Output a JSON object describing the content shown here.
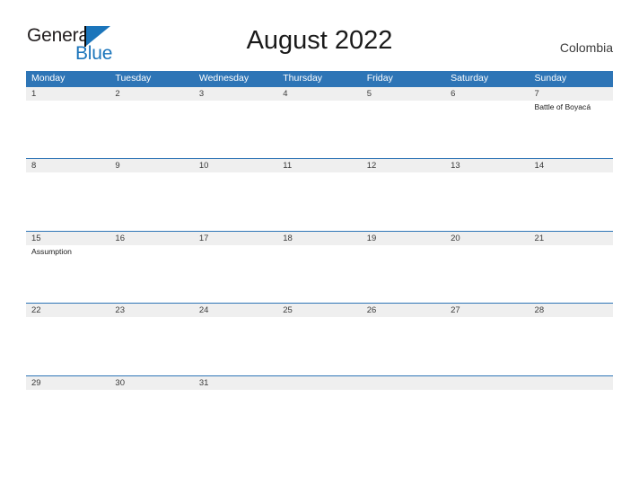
{
  "brand": {
    "name_part1": "General",
    "name_part2": "Blue",
    "flag_icon": "flag-triangle-icon",
    "accent_color": "#1b75bb"
  },
  "header": {
    "title": "August 2022",
    "locale": "Colombia"
  },
  "colors": {
    "header_blue": "#2e75b6",
    "band_gray": "#efefef",
    "text_dark": "#3a3a3a",
    "white": "#ffffff"
  },
  "calendar": {
    "month": "August",
    "year": "2022",
    "country": "Colombia",
    "weekdays": [
      "Monday",
      "Tuesday",
      "Wednesday",
      "Thursday",
      "Friday",
      "Saturday",
      "Sunday"
    ],
    "weeks": [
      {
        "days": [
          {
            "num": "1",
            "event": ""
          },
          {
            "num": "2",
            "event": ""
          },
          {
            "num": "3",
            "event": ""
          },
          {
            "num": "4",
            "event": ""
          },
          {
            "num": "5",
            "event": ""
          },
          {
            "num": "6",
            "event": ""
          },
          {
            "num": "7",
            "event": "Battle of Boyacá"
          }
        ]
      },
      {
        "days": [
          {
            "num": "8",
            "event": ""
          },
          {
            "num": "9",
            "event": ""
          },
          {
            "num": "10",
            "event": ""
          },
          {
            "num": "11",
            "event": ""
          },
          {
            "num": "12",
            "event": ""
          },
          {
            "num": "13",
            "event": ""
          },
          {
            "num": "14",
            "event": ""
          }
        ]
      },
      {
        "days": [
          {
            "num": "15",
            "event": "Assumption"
          },
          {
            "num": "16",
            "event": ""
          },
          {
            "num": "17",
            "event": ""
          },
          {
            "num": "18",
            "event": ""
          },
          {
            "num": "19",
            "event": ""
          },
          {
            "num": "20",
            "event": ""
          },
          {
            "num": "21",
            "event": ""
          }
        ]
      },
      {
        "days": [
          {
            "num": "22",
            "event": ""
          },
          {
            "num": "23",
            "event": ""
          },
          {
            "num": "24",
            "event": ""
          },
          {
            "num": "25",
            "event": ""
          },
          {
            "num": "26",
            "event": ""
          },
          {
            "num": "27",
            "event": ""
          },
          {
            "num": "28",
            "event": ""
          }
        ]
      },
      {
        "days": [
          {
            "num": "29",
            "event": ""
          },
          {
            "num": "30",
            "event": ""
          },
          {
            "num": "31",
            "event": ""
          },
          {
            "num": "",
            "event": ""
          },
          {
            "num": "",
            "event": ""
          },
          {
            "num": "",
            "event": ""
          },
          {
            "num": "",
            "event": ""
          }
        ]
      }
    ]
  }
}
